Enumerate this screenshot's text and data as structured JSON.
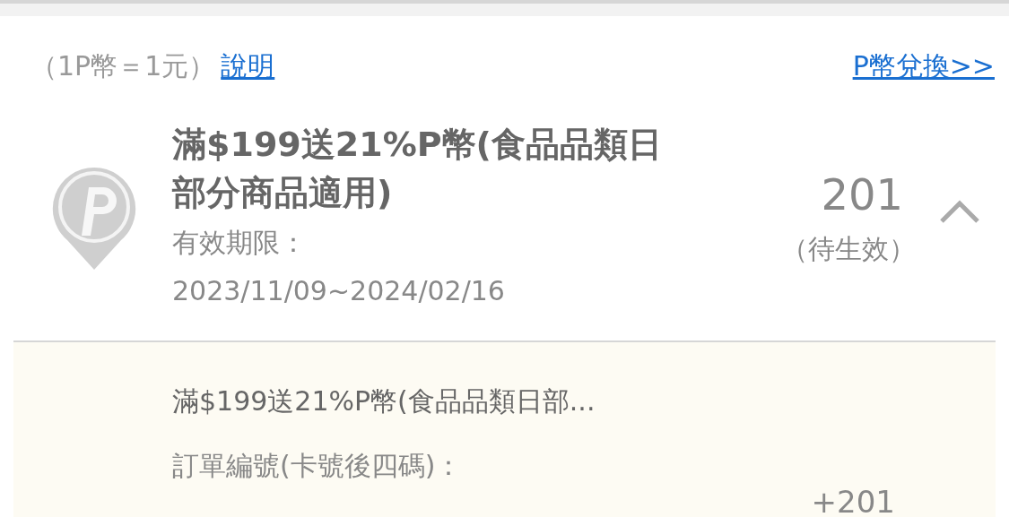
{
  "header": {
    "rate_note": "（1P幣＝1元）",
    "help_link": "說明",
    "exchange_link": "P幣兌換>>"
  },
  "points": [
    {
      "title": "滿$199送21%P幣(食品品類日部分商品適用)",
      "validity_label": "有效期限：",
      "validity_range": "2023/11/09~2024/02/16",
      "amount": "201",
      "status": "（待生效）",
      "expanded": true,
      "detail": {
        "title": "滿$199送21%P幣(食品品類日部...",
        "order_label": "訂單編號(卡號後四碼)：",
        "amount": "+201"
      }
    }
  ]
}
